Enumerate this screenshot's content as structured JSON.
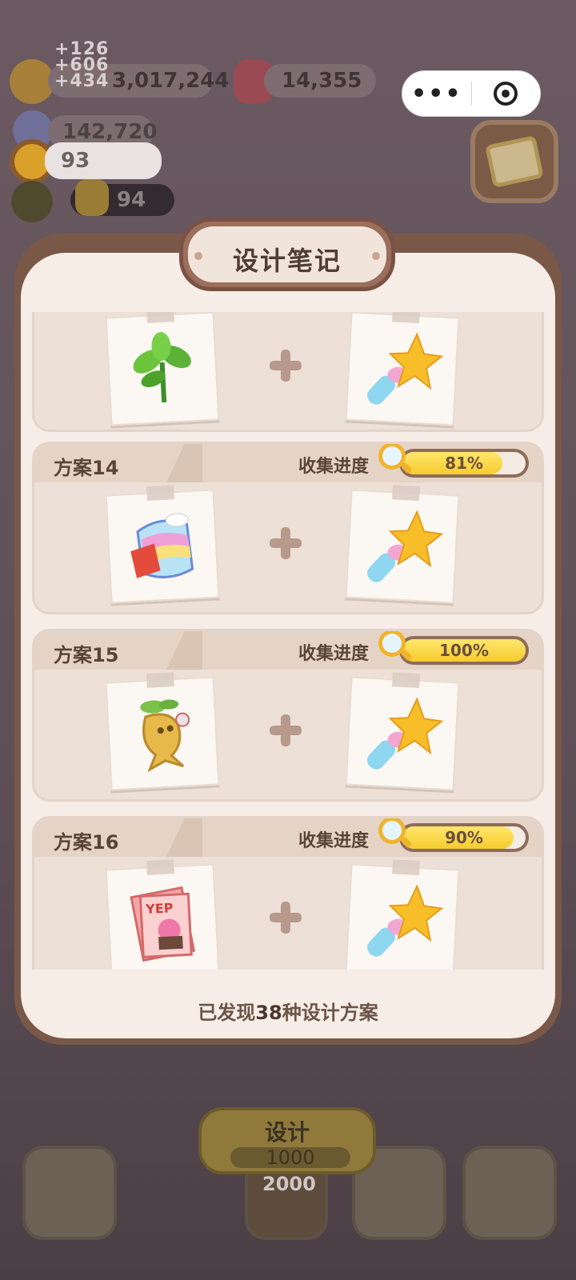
{
  "resources": {
    "coins": "3,017,244",
    "berries": "14,355",
    "gems": "142,720",
    "sunflowers": "93",
    "cookies": "94",
    "floating_gains": [
      "+126",
      "+606",
      "+434"
    ]
  },
  "capsule": {
    "more_icon": "more-dots-icon",
    "close_icon": "target-circle-icon"
  },
  "dialog": {
    "title": "设计笔记",
    "progress_label": "收集进度",
    "footer_prefix": "已发现",
    "footer_count": "38",
    "footer_suffix": "种设计方案"
  },
  "plans": [
    {
      "name": "",
      "progress": "",
      "progress_value": null,
      "item_a": "herb-leaves-icon",
      "item_b": "star-wand-icon"
    },
    {
      "name": "方案14",
      "progress": "81%",
      "progress_value": 81,
      "item_a": "rainbow-candy-icon",
      "item_b": "star-wand-icon"
    },
    {
      "name": "方案15",
      "progress": "100%",
      "progress_value": 100,
      "item_a": "ginseng-root-icon",
      "item_b": "star-wand-icon"
    },
    {
      "name": "方案16",
      "progress": "90%",
      "progress_value": 90,
      "item_a": "yep-magazine-icon",
      "item_b": "star-wand-icon"
    }
  ],
  "bottom": {
    "design_label": "设计",
    "design_cost": "1000",
    "secondary_cost": "2000"
  },
  "colors": {
    "progress_fill": "#f6cc2f",
    "frame": "#7a5848",
    "panel": "#f6ede6"
  }
}
